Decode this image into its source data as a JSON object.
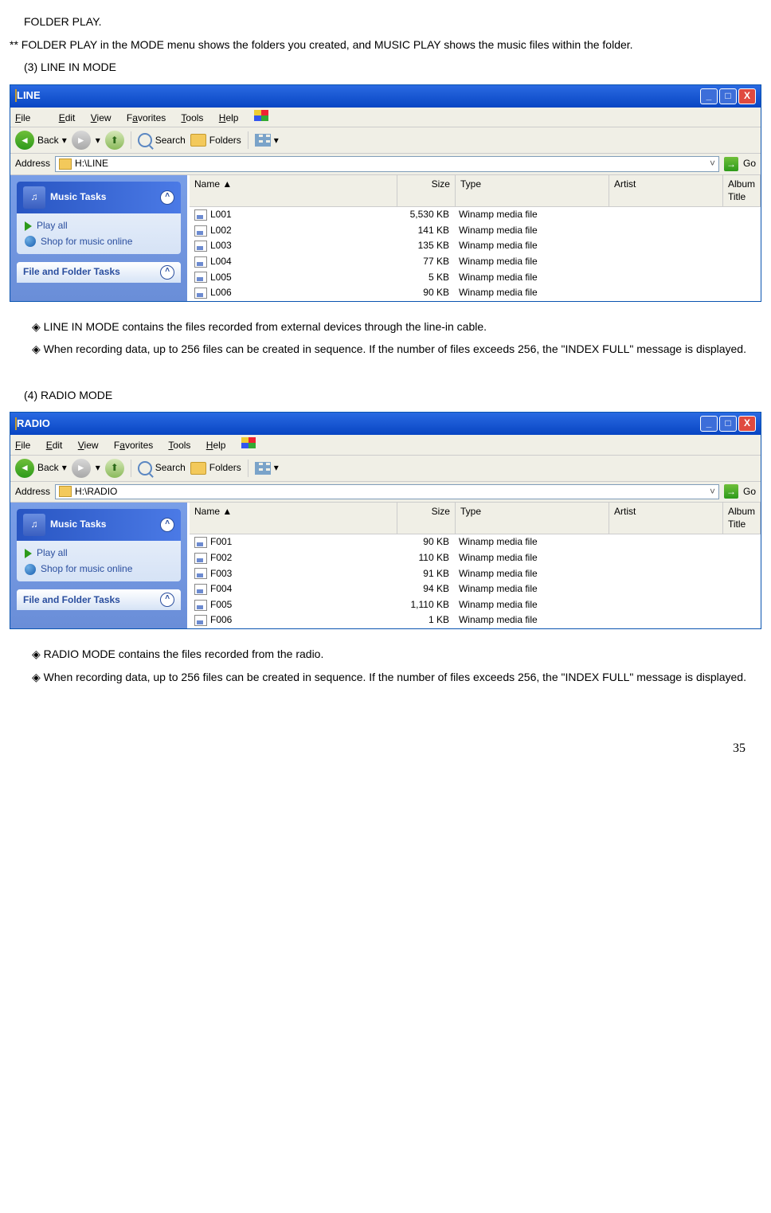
{
  "intro_line1": "FOLDER PLAY.",
  "intro_line2": "** FOLDER PLAY in the MODE menu shows the folders you created, and MUSIC PLAY shows the music files within the folder.",
  "sec3_title": "(3)  LINE IN MODE",
  "sec3_bullet1": "◈  LINE IN MODE contains the files recorded from external devices through the line-in cable.",
  "sec3_bullet2": "◈  When recording data, up to 256 files can be created in sequence. If the number of files exceeds 256, the \"INDEX FULL\" message is displayed.",
  "sec4_title": "(4)  RADIO MODE",
  "sec4_bullet1": "◈  RADIO MODE contains the files recorded from the radio.",
  "sec4_bullet2": "◈  When recording data, up to 256 files can be created in sequence. If the number of files exceeds 256, the \"INDEX FULL\" message is displayed.",
  "page_number": "35",
  "xp": {
    "menu": {
      "file": "File",
      "edit": "Edit",
      "view": "View",
      "favorites": "Favorites",
      "tools": "Tools",
      "help": "Help"
    },
    "toolbar": {
      "back": "Back",
      "search": "Search",
      "folders": "Folders"
    },
    "address_label": "Address",
    "go": "Go",
    "panel_music": "Music Tasks",
    "panel_play": "Play all",
    "panel_shop": "Shop for music online",
    "panel_ff": "File and Folder Tasks",
    "cols": {
      "name": "Name",
      "size": "Size",
      "type": "Type",
      "artist": "Artist",
      "album": "Album Title"
    }
  },
  "win1": {
    "title": "LINE",
    "address": "H:\\LINE",
    "rows": [
      {
        "n": "L001",
        "s": "5,530 KB",
        "t": "Winamp media file"
      },
      {
        "n": "L002",
        "s": "141 KB",
        "t": "Winamp media file"
      },
      {
        "n": "L003",
        "s": "135 KB",
        "t": "Winamp media file"
      },
      {
        "n": "L004",
        "s": "77 KB",
        "t": "Winamp media file"
      },
      {
        "n": "L005",
        "s": "5 KB",
        "t": "Winamp media file"
      },
      {
        "n": "L006",
        "s": "90 KB",
        "t": "Winamp media file"
      }
    ]
  },
  "win2": {
    "title": "RADIO",
    "address": "H:\\RADIO",
    "rows": [
      {
        "n": "F001",
        "s": "90 KB",
        "t": "Winamp media file"
      },
      {
        "n": "F002",
        "s": "110 KB",
        "t": "Winamp media file"
      },
      {
        "n": "F003",
        "s": "91 KB",
        "t": "Winamp media file"
      },
      {
        "n": "F004",
        "s": "94 KB",
        "t": "Winamp media file"
      },
      {
        "n": "F005",
        "s": "1,110 KB",
        "t": "Winamp media file"
      },
      {
        "n": "F006",
        "s": "1 KB",
        "t": "Winamp media file"
      }
    ]
  }
}
